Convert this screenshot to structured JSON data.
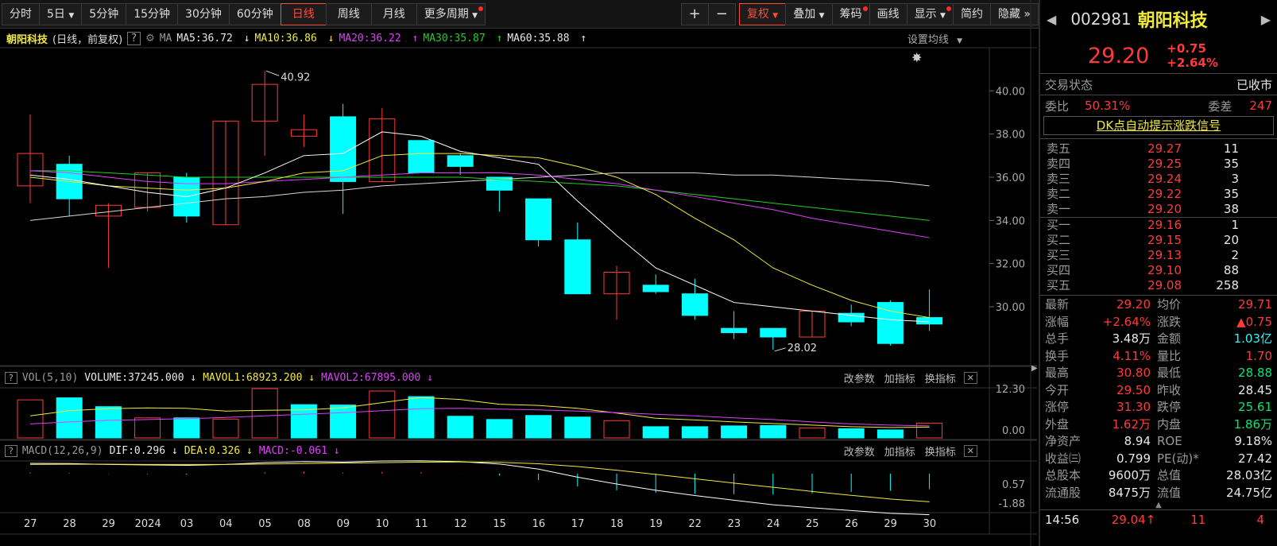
{
  "toolbar": {
    "items": [
      "分时",
      "5日",
      "5分钟",
      "15分钟",
      "30分钟",
      "60分钟",
      "日线",
      "周线",
      "月线",
      "更多周期"
    ],
    "zoom_in": "+",
    "zoom_out": "−",
    "fq": "复权",
    "overlay": "叠加",
    "chips": "筹码",
    "draw": "画线",
    "display": "显示",
    "simple": "简约",
    "hide": "隐藏"
  },
  "info": {
    "name": "朝阳科技",
    "mode": "(日线，前复权)",
    "help": "?",
    "ma": "MA",
    "ma5": "MA5:36.72",
    "ma10": "MA10:36.86",
    "ma20": "MA20:36.22",
    "ma30": "MA30:35.87",
    "ma60": "MA60:35.88",
    "setup": "设置均线"
  },
  "vol": {
    "label": "VOL(5,10)",
    "volume": "VOLUME:37245.000",
    "mavol1": "MAVOL1:68923.200",
    "mavol2": "MAVOL2:67895.000",
    "btns": [
      "改参数",
      "加指标",
      "换指标"
    ],
    "close": "✕",
    "ticks": [
      "12.30",
      "0.00"
    ]
  },
  "macd": {
    "label": "MACD(12,26,9)",
    "dif": "DIF:0.296",
    "dea": "DEA:0.326",
    "macd": "MACD:-0.061",
    "btns": [
      "改参数",
      "加指标",
      "换指标"
    ],
    "close": "✕",
    "ticks": [
      "0.57",
      "-1.88"
    ]
  },
  "chart_data": {
    "type": "candlestick",
    "title": "朝阳科技",
    "y_ticks": [
      "40.00",
      "38.00",
      "36.00",
      "34.00",
      "32.00",
      "30.00"
    ],
    "high_label": "40.92",
    "low_label": "28.02",
    "x_labels": [
      "27",
      "28",
      "29",
      "2024",
      "03",
      "04",
      "05",
      "08",
      "09",
      "10",
      "11",
      "12",
      "15",
      "16",
      "17",
      "18",
      "19",
      "22",
      "23",
      "24",
      "25",
      "26",
      "29",
      "30"
    ],
    "candles": [
      {
        "o": 35.6,
        "c": 37.1,
        "h": 38.9,
        "l": 34.8
      },
      {
        "o": 36.6,
        "c": 35.0,
        "h": 37.0,
        "l": 34.2
      },
      {
        "o": 34.2,
        "c": 34.7,
        "h": 34.8,
        "l": 31.8
      },
      {
        "o": 34.6,
        "c": 36.2,
        "h": 36.2,
        "l": 34.4
      },
      {
        "o": 36.0,
        "c": 34.2,
        "h": 36.2,
        "l": 33.9
      },
      {
        "o": 33.8,
        "c": 38.6,
        "h": 38.6,
        "l": 33.8
      },
      {
        "o": 38.6,
        "c": 40.3,
        "h": 40.92,
        "l": 37.0
      },
      {
        "o": 37.9,
        "c": 38.2,
        "h": 38.9,
        "l": 37.4
      },
      {
        "o": 38.8,
        "c": 35.8,
        "h": 39.4,
        "l": 34.3
      },
      {
        "o": 35.8,
        "c": 38.7,
        "h": 39.2,
        "l": 35.8
      },
      {
        "o": 37.7,
        "c": 36.2,
        "h": 37.7,
        "l": 36.2
      },
      {
        "o": 37.0,
        "c": 36.5,
        "h": 37.1,
        "l": 36.1
      },
      {
        "o": 36.0,
        "c": 35.4,
        "h": 36.0,
        "l": 34.4
      },
      {
        "o": 35.0,
        "c": 33.1,
        "h": 35.0,
        "l": 32.8
      },
      {
        "o": 33.1,
        "c": 30.6,
        "h": 33.9,
        "l": 30.6
      },
      {
        "o": 30.6,
        "c": 31.6,
        "h": 31.9,
        "l": 29.4
      },
      {
        "o": 31.0,
        "c": 30.7,
        "h": 31.5,
        "l": 30.6
      },
      {
        "o": 30.6,
        "c": 29.6,
        "h": 31.3,
        "l": 29.4
      },
      {
        "o": 29.0,
        "c": 28.8,
        "h": 29.8,
        "l": 28.5
      },
      {
        "o": 29.0,
        "c": 28.6,
        "h": 29.0,
        "l": 28.02
      },
      {
        "o": 28.6,
        "c": 29.8,
        "h": 29.8,
        "l": 28.6
      },
      {
        "o": 29.7,
        "c": 29.3,
        "h": 30.1,
        "l": 29.1
      },
      {
        "o": 30.2,
        "c": 28.3,
        "h": 30.3,
        "l": 28.2
      },
      {
        "o": 29.5,
        "c": 29.2,
        "h": 30.8,
        "l": 28.88
      }
    ],
    "ma5": [
      36.1,
      35.9,
      35.6,
      35.3,
      35.1,
      35.5,
      36.2,
      37.0,
      37.1,
      38.1,
      37.9,
      37.2,
      36.9,
      36.6,
      34.9,
      33.3,
      31.8,
      31.0,
      30.2,
      30.0,
      29.8,
      29.6,
      29.4,
      29.3
    ],
    "ma10": [
      36.0,
      35.8,
      35.6,
      35.5,
      35.4,
      35.5,
      35.8,
      36.2,
      36.3,
      37.0,
      37.1,
      37.1,
      37.0,
      36.9,
      36.5,
      36.0,
      35.2,
      34.1,
      33.1,
      31.8,
      31.0,
      30.3,
      29.8,
      29.5
    ],
    "ma20": [
      36.3,
      36.2,
      36.0,
      35.8,
      35.7,
      35.7,
      35.8,
      35.9,
      36.0,
      36.1,
      36.2,
      36.2,
      36.2,
      36.1,
      35.9,
      35.7,
      35.4,
      35.1,
      34.8,
      34.5,
      34.1,
      33.8,
      33.5,
      33.2
    ],
    "ma30": [
      36.3,
      36.3,
      36.2,
      36.1,
      36.0,
      36.0,
      36.0,
      36.0,
      36.0,
      36.0,
      36.0,
      36.0,
      35.9,
      35.8,
      35.7,
      35.6,
      35.4,
      35.2,
      35.0,
      34.8,
      34.6,
      34.4,
      34.2,
      34.0
    ],
    "ma60": [
      34.0,
      34.2,
      34.4,
      34.6,
      34.8,
      35.0,
      35.1,
      35.3,
      35.4,
      35.6,
      35.7,
      35.8,
      35.9,
      36.0,
      36.1,
      36.2,
      36.2,
      36.2,
      36.1,
      36.1,
      36.0,
      35.9,
      35.8,
      35.6
    ],
    "volume": [
      9.5,
      10.0,
      7.8,
      5.0,
      5.0,
      4.7,
      12.3,
      8.3,
      8.2,
      11.7,
      10.3,
      5.4,
      4.6,
      5.6,
      5.2,
      4.3,
      2.8,
      2.8,
      3.0,
      3.1,
      2.5,
      2.3,
      2.0,
      3.7
    ],
    "vol_up": [
      true,
      false,
      false,
      true,
      false,
      true,
      true,
      false,
      false,
      true,
      false,
      false,
      false,
      false,
      false,
      true,
      false,
      false,
      false,
      false,
      true,
      false,
      false,
      true
    ],
    "mavol1": [
      5.5,
      6.8,
      7.3,
      7.5,
      7.4,
      6.7,
      6.9,
      7.0,
      7.5,
      8.8,
      10.1,
      9.6,
      8.4,
      8.1,
      7.4,
      6.2,
      4.9,
      4.5,
      4.0,
      3.6,
      3.2,
      2.8,
      2.6,
      2.7
    ],
    "mavol2": [
      3.5,
      4.0,
      4.4,
      4.6,
      4.8,
      5.1,
      5.5,
      5.9,
      6.3,
      6.8,
      7.3,
      7.4,
      7.2,
      7.0,
      6.7,
      6.3,
      5.9,
      5.5,
      5.0,
      4.6,
      4.0,
      3.5,
      3.2,
      3.0
    ],
    "dif": [
      0.45,
      0.44,
      0.4,
      0.38,
      0.36,
      0.4,
      0.48,
      0.52,
      0.5,
      0.55,
      0.56,
      0.52,
      0.42,
      0.2,
      -0.15,
      -0.45,
      -0.72,
      -0.95,
      -1.15,
      -1.35,
      -1.48,
      -1.6,
      -1.72,
      -1.78
    ],
    "dea": [
      0.4,
      0.41,
      0.41,
      0.4,
      0.4,
      0.4,
      0.42,
      0.44,
      0.46,
      0.48,
      0.5,
      0.51,
      0.49,
      0.43,
      0.31,
      0.15,
      -0.03,
      -0.22,
      -0.41,
      -0.59,
      -0.77,
      -0.94,
      -1.1,
      -1.22
    ],
    "macdbar": [
      0.1,
      0.06,
      -0.02,
      -0.04,
      -0.08,
      0.0,
      0.12,
      0.16,
      0.08,
      0.14,
      0.12,
      0.02,
      -0.14,
      -0.46,
      -0.92,
      -1.2,
      -1.38,
      -1.46,
      -1.48,
      -1.52,
      -1.42,
      -1.32,
      -1.24,
      -1.12
    ]
  },
  "quote": {
    "code": "002981",
    "name": "朝阳科技",
    "price": "29.20",
    "chg": "+0.75",
    "pct": "+2.64%",
    "status_label": "交易状态",
    "status": "已收市",
    "wb_label": "委比",
    "wb": "50.31%",
    "wc_label": "委差",
    "wc": "247",
    "signal": "DK点自动提示涨跌信号",
    "asks": [
      [
        "卖五",
        "29.27",
        "11"
      ],
      [
        "卖四",
        "29.25",
        "35"
      ],
      [
        "卖三",
        "29.24",
        "3"
      ],
      [
        "卖二",
        "29.22",
        "35"
      ],
      [
        "卖一",
        "29.20",
        "38"
      ]
    ],
    "bids": [
      [
        "买一",
        "29.16",
        "1"
      ],
      [
        "买二",
        "29.15",
        "20"
      ],
      [
        "买三",
        "29.13",
        "2"
      ],
      [
        "买四",
        "29.10",
        "88"
      ],
      [
        "买五",
        "29.08",
        "258"
      ]
    ],
    "stats": [
      [
        "最新",
        "29.20",
        "均价",
        "29.71"
      ],
      [
        "涨幅",
        "+2.64%",
        "涨跌",
        "▲0.75"
      ],
      [
        "总手",
        "3.48万",
        "金额",
        "1.03亿"
      ],
      [
        "换手",
        "4.11%",
        "量比",
        "1.70"
      ],
      [
        "最高",
        "30.80",
        "最低",
        "28.88"
      ],
      [
        "今开",
        "29.50",
        "昨收",
        "28.45"
      ],
      [
        "涨停",
        "31.30",
        "跌停",
        "25.61"
      ],
      [
        "外盘",
        "1.62万",
        "内盘",
        "1.86万"
      ],
      [
        "净资产",
        "8.94",
        "ROE",
        "9.18%"
      ],
      [
        "收益㈢",
        "0.799",
        "PE(动)*",
        "27.42"
      ],
      [
        "总股本",
        "9600万",
        "总值",
        "28.03亿"
      ],
      [
        "流通股",
        "8475万",
        "流值",
        "24.75亿"
      ]
    ],
    "tick": {
      "time": "14:56",
      "price": "29.04↑",
      "vol": "11",
      "n": "4"
    }
  },
  "colors": {
    "up": "#ff3b3b",
    "down": "#00ffff",
    "ma5": "#ffffff",
    "ma10": "#f2ea3a",
    "ma20": "#e040fb",
    "ma30": "#20d020",
    "ma60": "#d8d8d8"
  }
}
